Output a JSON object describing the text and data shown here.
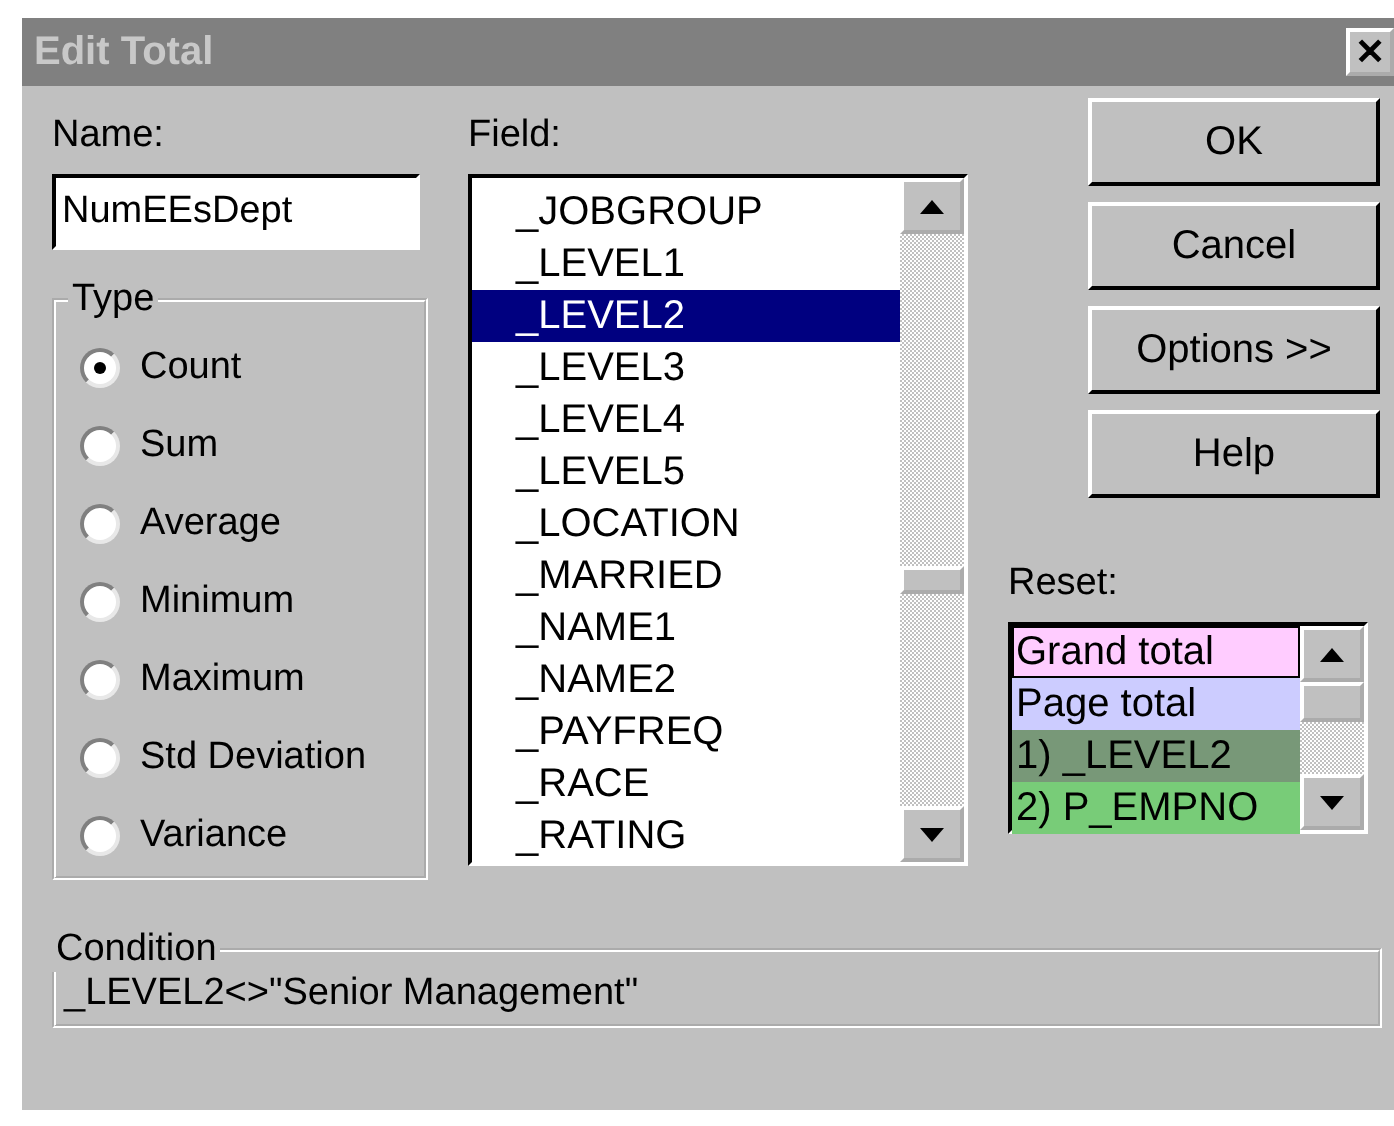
{
  "window": {
    "title": "Edit Total",
    "close": "✕"
  },
  "name": {
    "label": "Name:",
    "value": "NumEEsDept"
  },
  "type": {
    "label": "Type",
    "options": [
      {
        "label": "Count",
        "selected": true
      },
      {
        "label": "Sum",
        "selected": false
      },
      {
        "label": "Average",
        "selected": false
      },
      {
        "label": "Minimum",
        "selected": false
      },
      {
        "label": "Maximum",
        "selected": false
      },
      {
        "label": "Std Deviation",
        "selected": false
      },
      {
        "label": "Variance",
        "selected": false
      }
    ]
  },
  "field": {
    "label": "Field:",
    "items": [
      {
        "label": "_JOBGROUP",
        "selected": false
      },
      {
        "label": "_LEVEL1",
        "selected": false
      },
      {
        "label": "_LEVEL2",
        "selected": true
      },
      {
        "label": "_LEVEL3",
        "selected": false
      },
      {
        "label": "_LEVEL4",
        "selected": false
      },
      {
        "label": "_LEVEL5",
        "selected": false
      },
      {
        "label": "_LOCATION",
        "selected": false
      },
      {
        "label": "_MARRIED",
        "selected": false
      },
      {
        "label": "_NAME1",
        "selected": false
      },
      {
        "label": "_NAME2",
        "selected": false
      },
      {
        "label": "_PAYFREQ",
        "selected": false
      },
      {
        "label": "_RACE",
        "selected": false
      },
      {
        "label": "_RATING",
        "selected": false
      }
    ]
  },
  "buttons": [
    "OK",
    "Cancel",
    "Options >>",
    "Help"
  ],
  "reset": {
    "label": "Reset:",
    "items": [
      {
        "label": "Grand total",
        "selected": true,
        "color": "#ffccff"
      },
      {
        "label": "Page total",
        "selected": false,
        "color": "#ccccff"
      },
      {
        "label": "1) _LEVEL2",
        "selected": false,
        "color": "#789878"
      },
      {
        "label": "2) P_EMPNO",
        "selected": false,
        "color": "#78cc78"
      }
    ]
  },
  "condition": {
    "label": "Condition",
    "value": "_LEVEL2<>\"Senior Management\""
  }
}
